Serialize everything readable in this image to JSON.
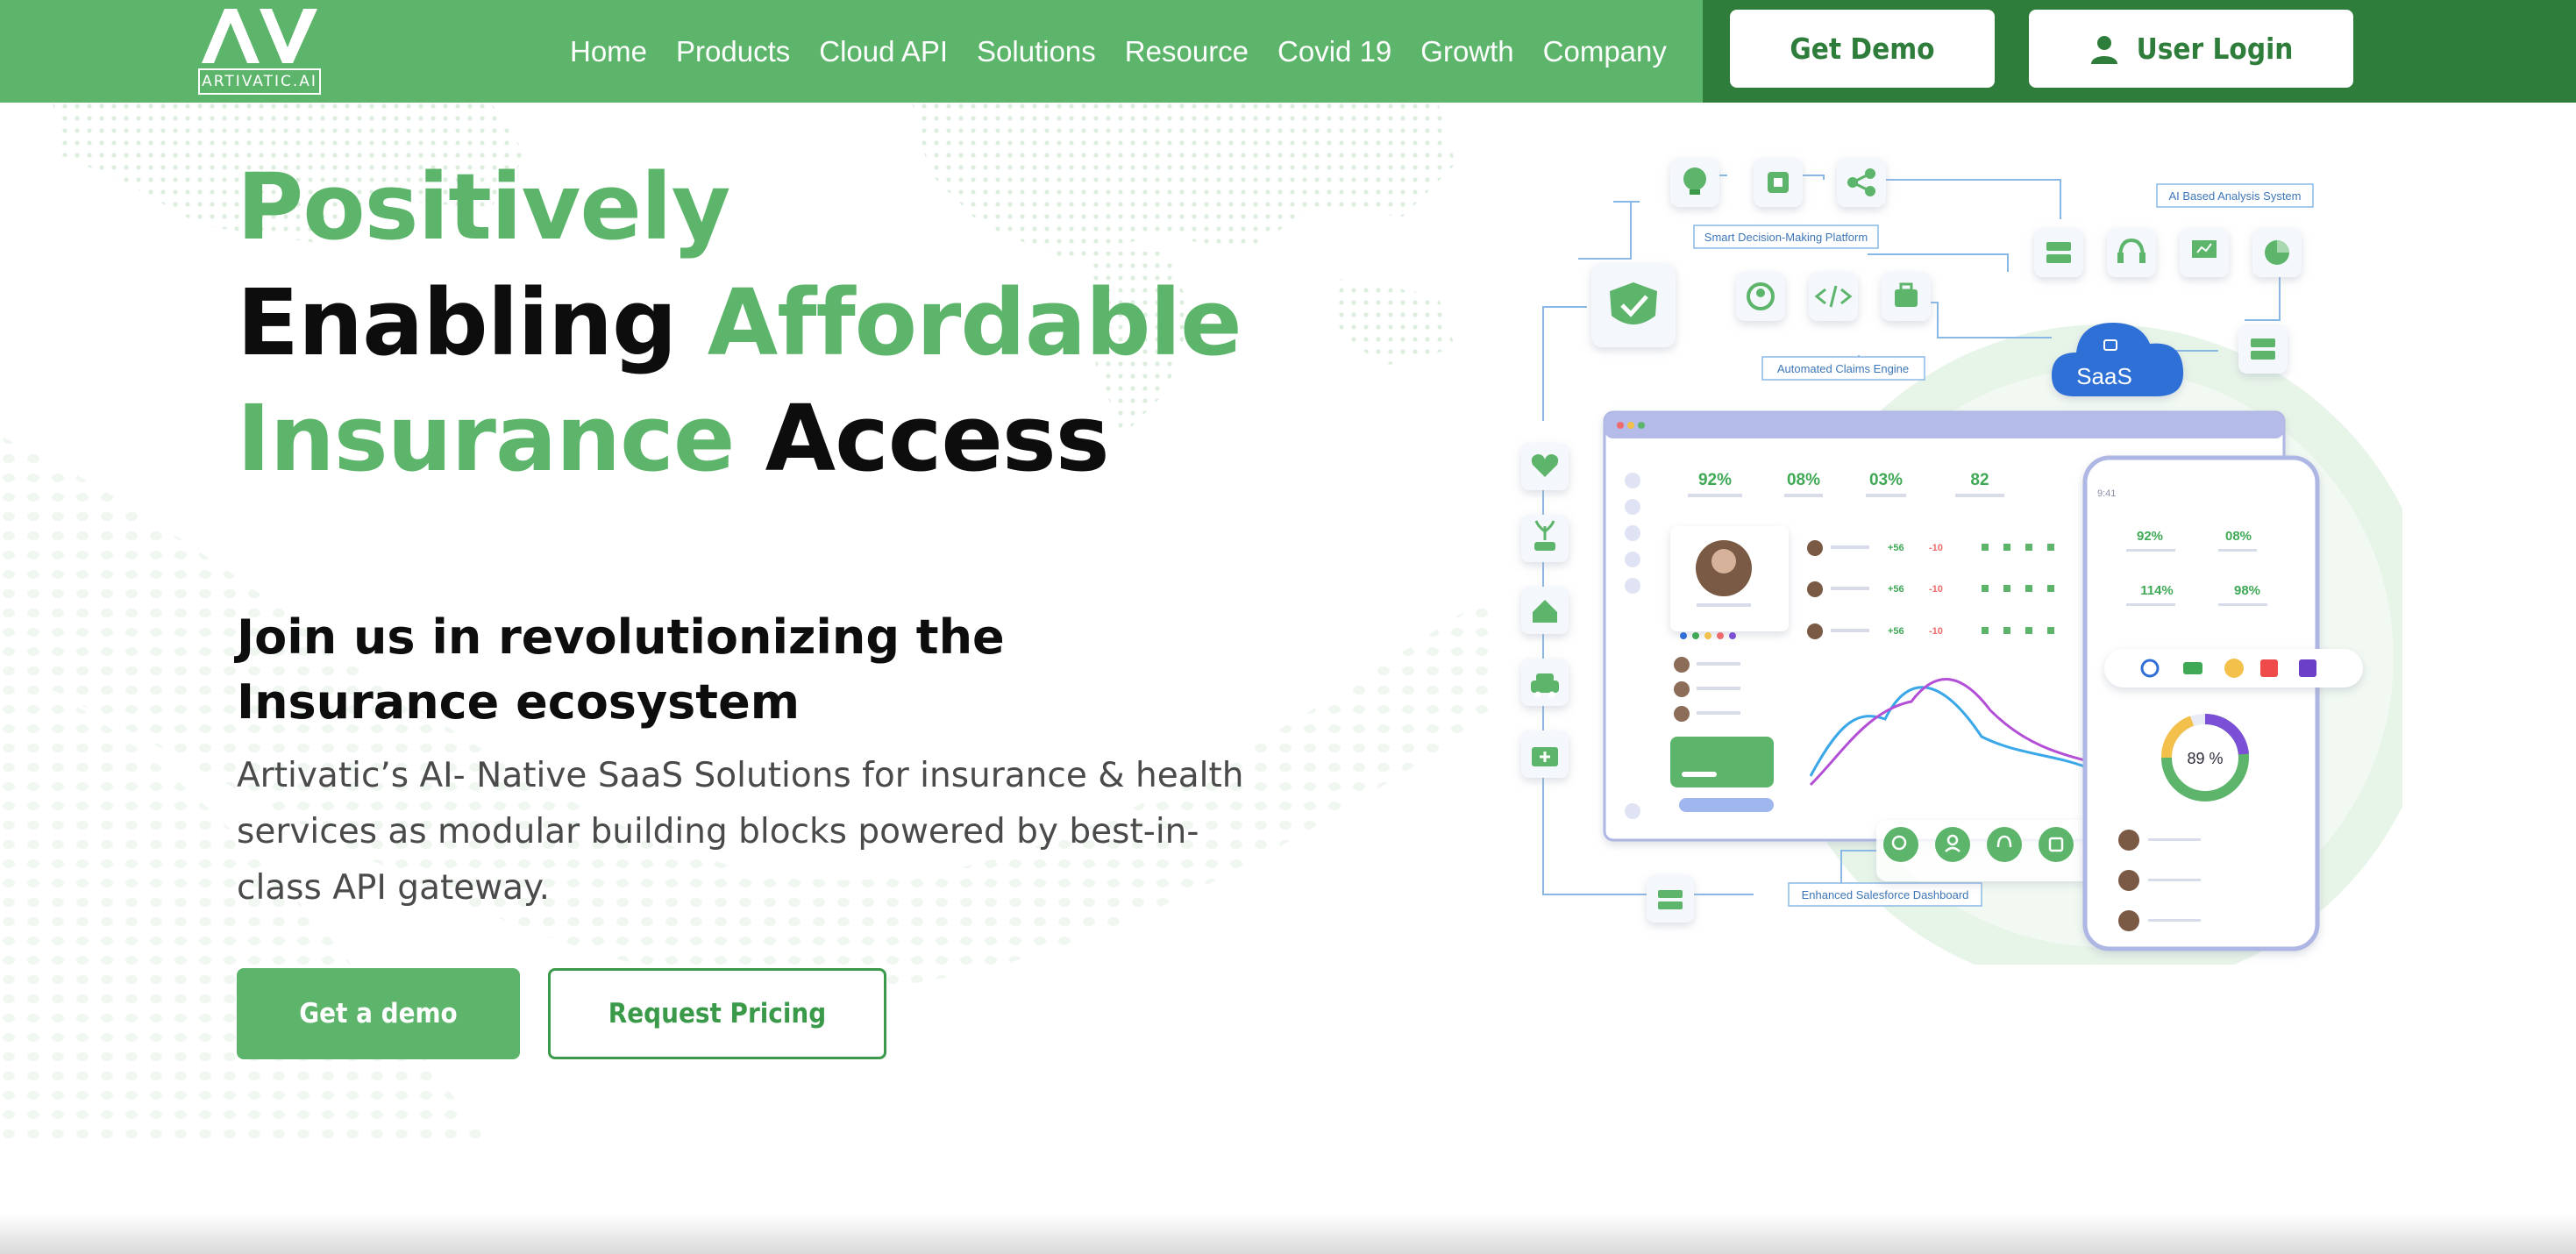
{
  "header": {
    "logo_mark": "AV",
    "logo_text": "ARTIVATIC.AI",
    "nav": [
      {
        "label": "Home"
      },
      {
        "label": "Products"
      },
      {
        "label": "Cloud API"
      },
      {
        "label": "Solutions"
      },
      {
        "label": "Resource"
      },
      {
        "label": "Covid 19"
      },
      {
        "label": "Growth"
      },
      {
        "label": "Company"
      }
    ],
    "get_demo_label": "Get Demo",
    "user_login_label": "User Login",
    "user_icon": "user-icon"
  },
  "hero": {
    "title_line1_green": "Positively",
    "title_line2_black": "Enabling ",
    "title_line2_green": "Affordable",
    "title_line3_green": "Insurance ",
    "title_line3_black": "Access",
    "subheading": "Join us in revolutionizing the Insurance ecosystem",
    "description": "Artivatic’s AI- Native SaaS Solutions for insurance & health services as modular building blocks powered by best-in-class API gateway.",
    "cta_primary": "Get a demo",
    "cta_secondary": "Request Pricing"
  },
  "illustration": {
    "label_smart": "Smart Decision-Making Platform",
    "label_ai": "AI Based Analysis System",
    "label_claims": "Automated Claims Engine",
    "label_sales": "Enhanced Salesforce Dashboard",
    "cloud_label": "SaaS",
    "dash_stats": [
      "92%",
      "08%",
      "03%",
      "82"
    ],
    "phone_stats": [
      "92%",
      "08%",
      "114%",
      "98%"
    ],
    "phone_time": "9:41",
    "donut_value": "89 %",
    "arrow_up": "+56",
    "arrow_down": "-10"
  },
  "colors": {
    "brand_green": "#5cb56a",
    "dark_green": "#2f7d3b",
    "text_dark": "#0d0d0d",
    "text_grey": "#4a4a4a"
  }
}
